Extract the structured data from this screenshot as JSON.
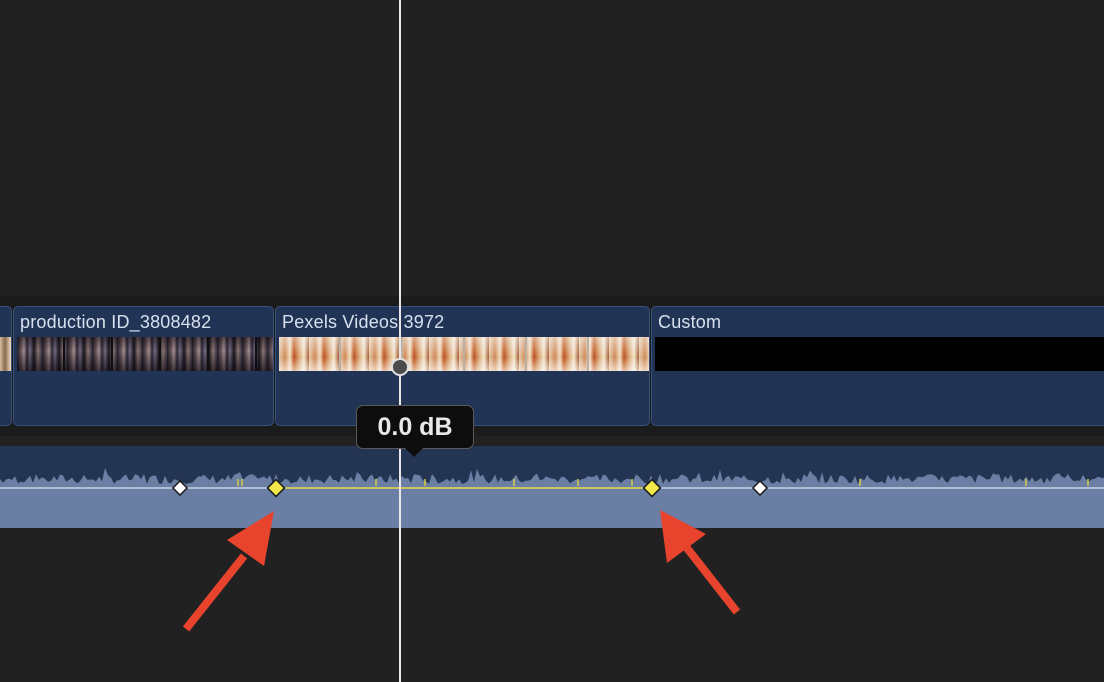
{
  "timeline": {
    "clips": [
      {
        "title": "",
        "strip": "strip-prev"
      },
      {
        "title": "production ID_3808482",
        "strip": "strip-crowd"
      },
      {
        "title": "Pexels Videos 3972",
        "strip": "strip-food"
      },
      {
        "title": "Custom",
        "strip": "strip-black"
      }
    ],
    "volume_tooltip": "0.0 dB",
    "keyframes": [
      {
        "state": "unselected",
        "color": "#ffffff"
      },
      {
        "state": "selected",
        "color": "#f3e94a"
      },
      {
        "state": "selected",
        "color": "#f3e94a"
      },
      {
        "state": "unselected",
        "color": "#ffffff"
      }
    ],
    "annotation_arrows": 2
  },
  "colors": {
    "background": "#212121",
    "clip_fill": "#223455",
    "audio_wave": "#6a7fa3",
    "volume_line": "#c7d2e6",
    "selected_range_line": "#d8cf3c",
    "annotation_arrow": "#e8432c",
    "playhead": "#e8e8e8"
  }
}
